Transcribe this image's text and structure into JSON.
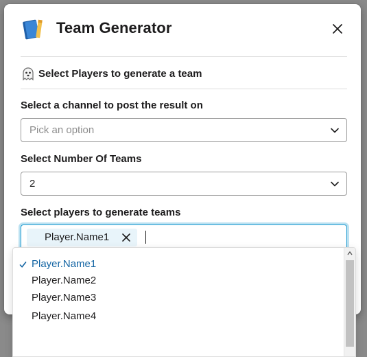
{
  "modal": {
    "title": "Team Generator",
    "app_icon": "book-icon",
    "close_icon": "close-icon"
  },
  "section": {
    "emoji": "ghost-icon",
    "heading": "Select Players to generate a team"
  },
  "fields": {
    "channel": {
      "label": "Select a channel to post the result on",
      "placeholder": "Pick an option"
    },
    "num_teams": {
      "label": "Select Number Of Teams",
      "value": "2"
    },
    "players": {
      "label": "Select players to generate teams",
      "selected_chips": [
        "Player.Name1"
      ]
    }
  },
  "dropdown": {
    "options": [
      {
        "label": "Player.Name1",
        "selected": true
      },
      {
        "label": "Player.Name2",
        "selected": false
      },
      {
        "label": "Player.Name3",
        "selected": false
      },
      {
        "label": "Player.Name4",
        "selected": false
      }
    ]
  },
  "colors": {
    "accent": "#1264a3",
    "focus_border": "#1d9bd1",
    "chip_bg": "#e8f4fa",
    "overlay": "#8a8a8a"
  }
}
